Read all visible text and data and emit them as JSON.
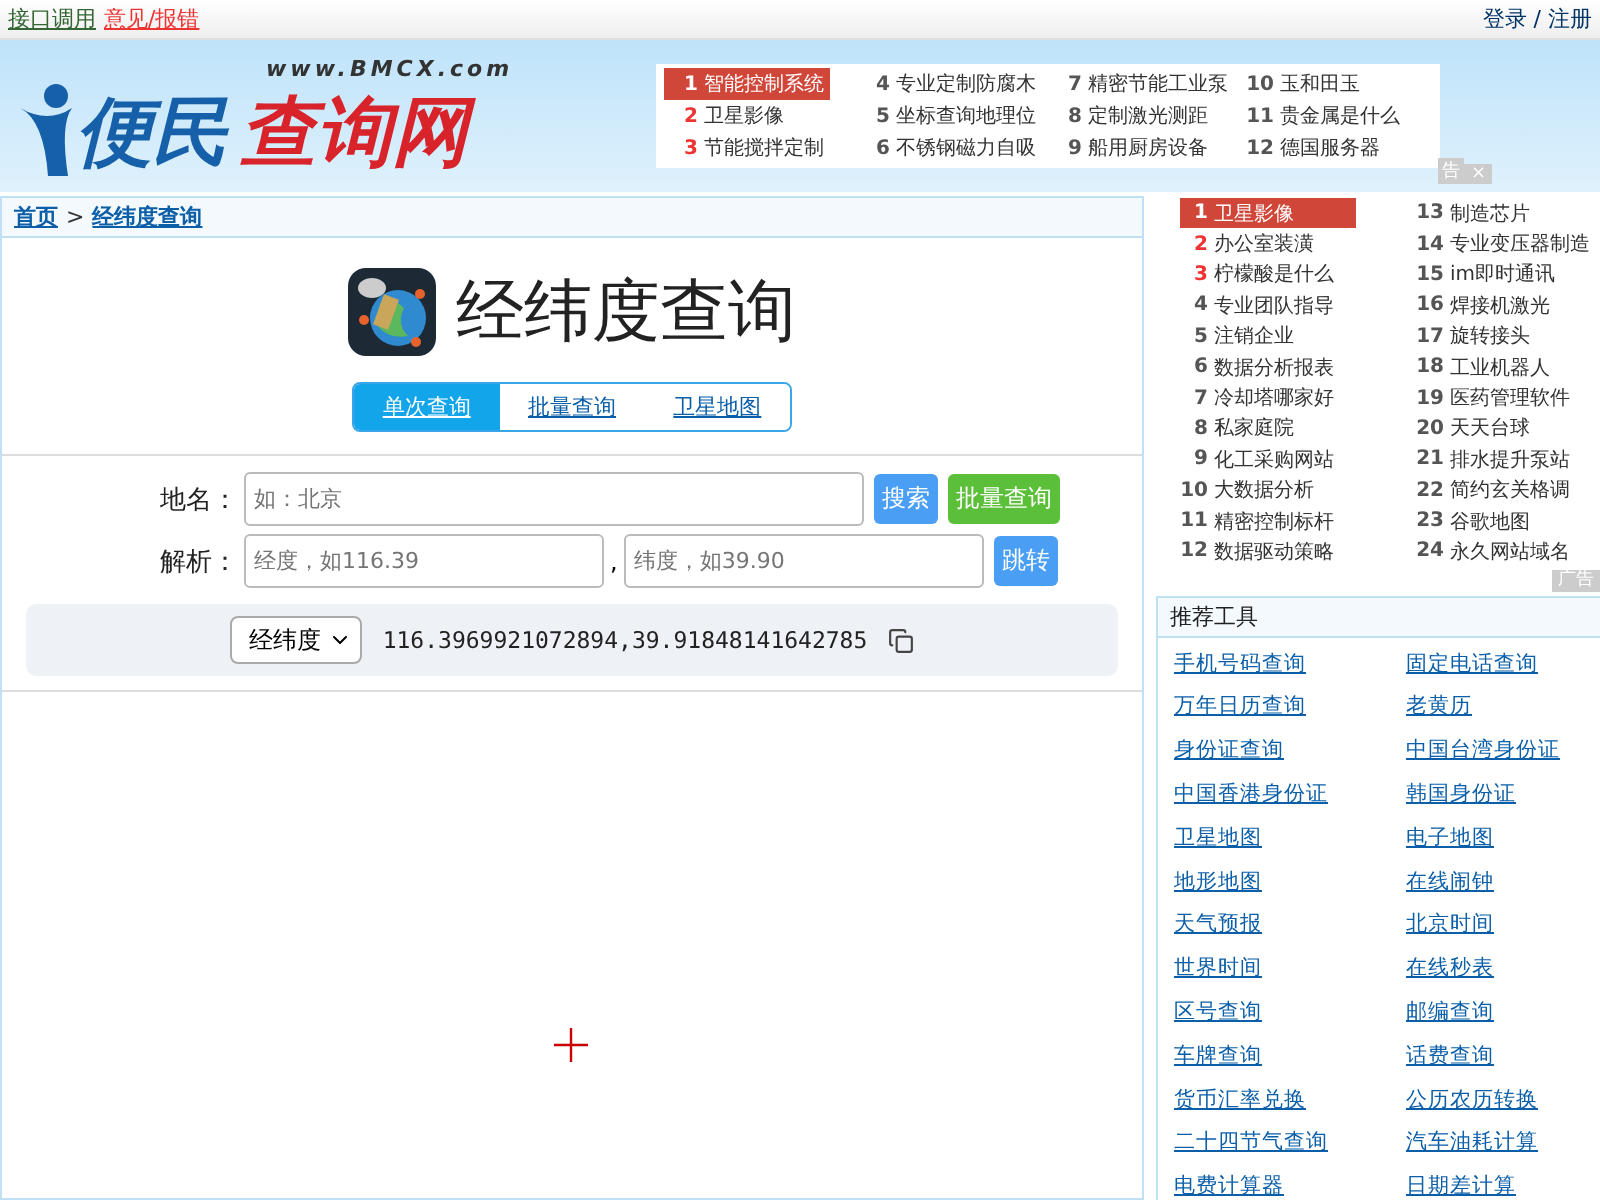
{
  "top_bar": {
    "links": [
      {
        "label": "接口调用",
        "kind": "plain"
      },
      {
        "label": "意见/报错",
        "kind": "alert"
      }
    ],
    "account": "登录 / 注册"
  },
  "logo": {
    "part_1": "便民",
    "part_2": "查询网",
    "url": "www.BMCX.com"
  },
  "ad_list": {
    "items": [
      {
        "num": "1",
        "label": "智能控制系统",
        "kind": "first"
      },
      {
        "num": "2",
        "label": "卫星影像",
        "kind": "hot"
      },
      {
        "num": "3",
        "label": "节能搅拌定制",
        "kind": "hot"
      },
      {
        "num": "4",
        "label": "专业定制防腐木",
        "kind": "plain"
      },
      {
        "num": "5",
        "label": "坐标查询地理位",
        "kind": "plain"
      },
      {
        "num": "6",
        "label": "不锈钢磁力自吸",
        "kind": "plain"
      },
      {
        "num": "7",
        "label": "精密节能工业泵",
        "kind": "plain"
      },
      {
        "num": "8",
        "label": "定制激光测距",
        "kind": "plain"
      },
      {
        "num": "9",
        "label": "船用厨房设备",
        "kind": "plain"
      },
      {
        "num": "10",
        "label": "玉和田玉",
        "kind": "plain"
      },
      {
        "num": "11",
        "label": "贵金属是什么",
        "kind": "plain"
      },
      {
        "num": "12",
        "label": "德国服务器",
        "kind": "plain"
      }
    ],
    "ad_mark": "告",
    "close": "×"
  },
  "breadcrumb": {
    "home": "首页",
    "separator": ">",
    "current": "经纬度查询"
  },
  "title": "经纬度查询",
  "tabs": [
    {
      "label": "单次查询",
      "selected": true
    },
    {
      "label": "批量查询",
      "selected": false
    },
    {
      "label": "卫星地图",
      "selected": false
    }
  ],
  "form": {
    "place_label": "地名：",
    "place_placeholder": "如：北京",
    "search_button": "搜索",
    "batch_button": "批量查询",
    "parse_label": "解析：",
    "lng_placeholder": "经度，如116.39",
    "comma": ",",
    "lat_placeholder": "纬度，如39.90",
    "jump_button": "跳转"
  },
  "result": {
    "format": "经纬度",
    "value": "116.3969921072894,39.91848141642785"
  },
  "hot_list": {
    "items": [
      {
        "num": "1",
        "label": "卫星影像",
        "kind": "first"
      },
      {
        "num": "2",
        "label": "办公室装潢",
        "kind": "hot"
      },
      {
        "num": "3",
        "label": "柠檬酸是什么",
        "kind": "hot"
      },
      {
        "num": "4",
        "label": "专业团队指导",
        "kind": "plain"
      },
      {
        "num": "5",
        "label": "注销企业",
        "kind": "plain"
      },
      {
        "num": "6",
        "label": "数据分析报表",
        "kind": "plain"
      },
      {
        "num": "7",
        "label": "冷却塔哪家好",
        "kind": "plain"
      },
      {
        "num": "8",
        "label": "私家庭院",
        "kind": "plain"
      },
      {
        "num": "9",
        "label": "化工采购网站",
        "kind": "plain"
      },
      {
        "num": "10",
        "label": "大数据分析",
        "kind": "plain"
      },
      {
        "num": "11",
        "label": "精密控制标杆",
        "kind": "plain"
      },
      {
        "num": "12",
        "label": "数据驱动策略",
        "kind": "plain"
      },
      {
        "num": "13",
        "label": "制造芯片",
        "kind": "plain"
      },
      {
        "num": "14",
        "label": "专业变压器制造",
        "kind": "plain"
      },
      {
        "num": "15",
        "label": "im即时通讯",
        "kind": "plain"
      },
      {
        "num": "16",
        "label": "焊接机激光",
        "kind": "plain"
      },
      {
        "num": "17",
        "label": "旋转接头",
        "kind": "plain"
      },
      {
        "num": "18",
        "label": "工业机器人",
        "kind": "plain"
      },
      {
        "num": "19",
        "label": "医药管理软件",
        "kind": "plain"
      },
      {
        "num": "20",
        "label": "天天台球",
        "kind": "plain"
      },
      {
        "num": "21",
        "label": "排水提升泵站",
        "kind": "plain"
      },
      {
        "num": "22",
        "label": "简约玄关格调",
        "kind": "plain"
      },
      {
        "num": "23",
        "label": "谷歌地图",
        "kind": "plain"
      },
      {
        "num": "24",
        "label": "永久网站域名",
        "kind": "plain"
      }
    ],
    "ad_mark": "广告"
  },
  "tools": {
    "title": "推荐工具",
    "links": [
      "手机号码查询",
      "固定电话查询",
      "万年日历查询",
      "老黄历",
      "身份证查询",
      "中国台湾身份证",
      "中国香港身份证",
      "韩国身份证",
      "卫星地图",
      "电子地图",
      "地形地图",
      "在线闹钟",
      "天气预报",
      "北京时间",
      "世界时间",
      "在线秒表",
      "区号查询",
      "邮编查询",
      "车牌查询",
      "话费查询",
      "货币汇率兑换",
      "公历农历转换",
      "二十四节气查询",
      "汽车油耗计算",
      "电费计算器",
      "日期差计算"
    ]
  }
}
